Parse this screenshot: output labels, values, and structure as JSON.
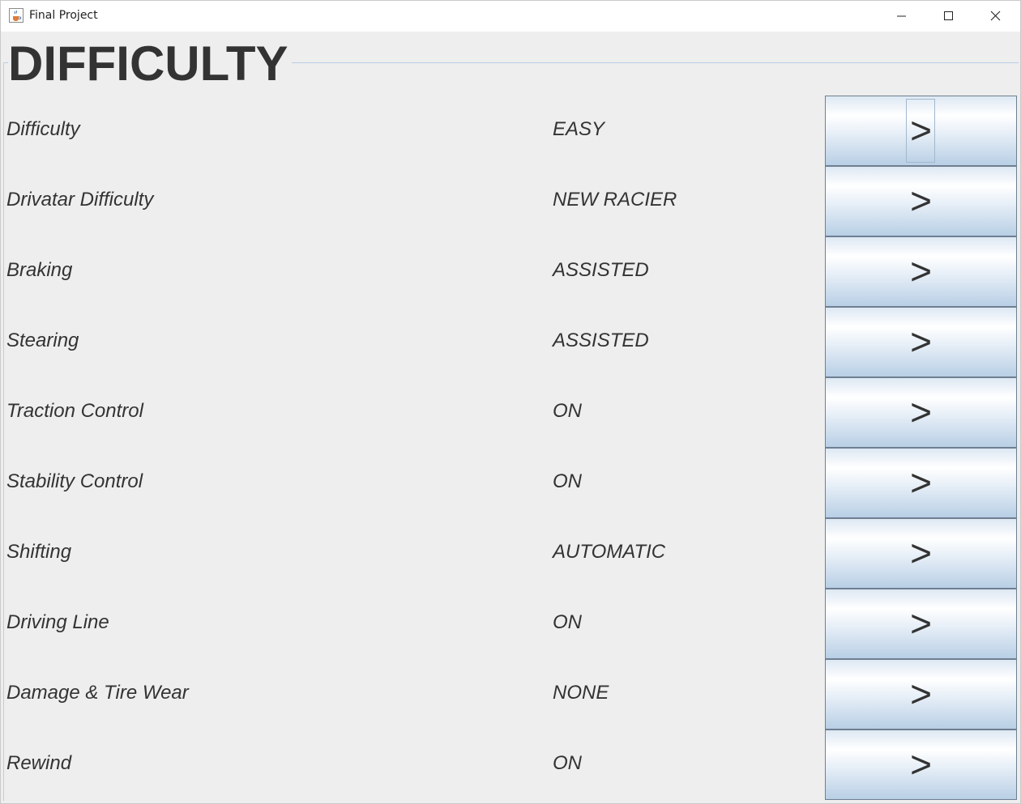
{
  "window": {
    "title": "Final Project",
    "app_icon": "java-cup-icon",
    "controls": [
      "minimize-icon",
      "maximize-icon",
      "close-icon"
    ]
  },
  "page": {
    "title": "DIFFICULTY"
  },
  "settings": [
    {
      "label": "Difficulty",
      "value": "EASY",
      "button": ">"
    },
    {
      "label": "Drivatar Difficulty",
      "value": "NEW RACIER",
      "button": ">"
    },
    {
      "label": "Braking",
      "value": "ASSISTED",
      "button": ">"
    },
    {
      "label": "Stearing",
      "value": "ASSISTED",
      "button": ">"
    },
    {
      "label": "Traction Control",
      "value": "ON",
      "button": ">"
    },
    {
      "label": "Stability Control",
      "value": "ON",
      "button": ">"
    },
    {
      "label": "Shifting",
      "value": "AUTOMATIC",
      "button": ">"
    },
    {
      "label": "Driving Line",
      "value": "ON",
      "button": ">"
    },
    {
      "label": "Damage & Tire Wear",
      "value": "NONE",
      "button": ">"
    },
    {
      "label": "Rewind",
      "value": "ON",
      "button": ">"
    }
  ],
  "colors": {
    "background": "#eeeeee",
    "text": "#333333",
    "button_top": "#dde8f3",
    "button_bottom": "#b8cfe5",
    "button_border": "#6f7f91"
  }
}
